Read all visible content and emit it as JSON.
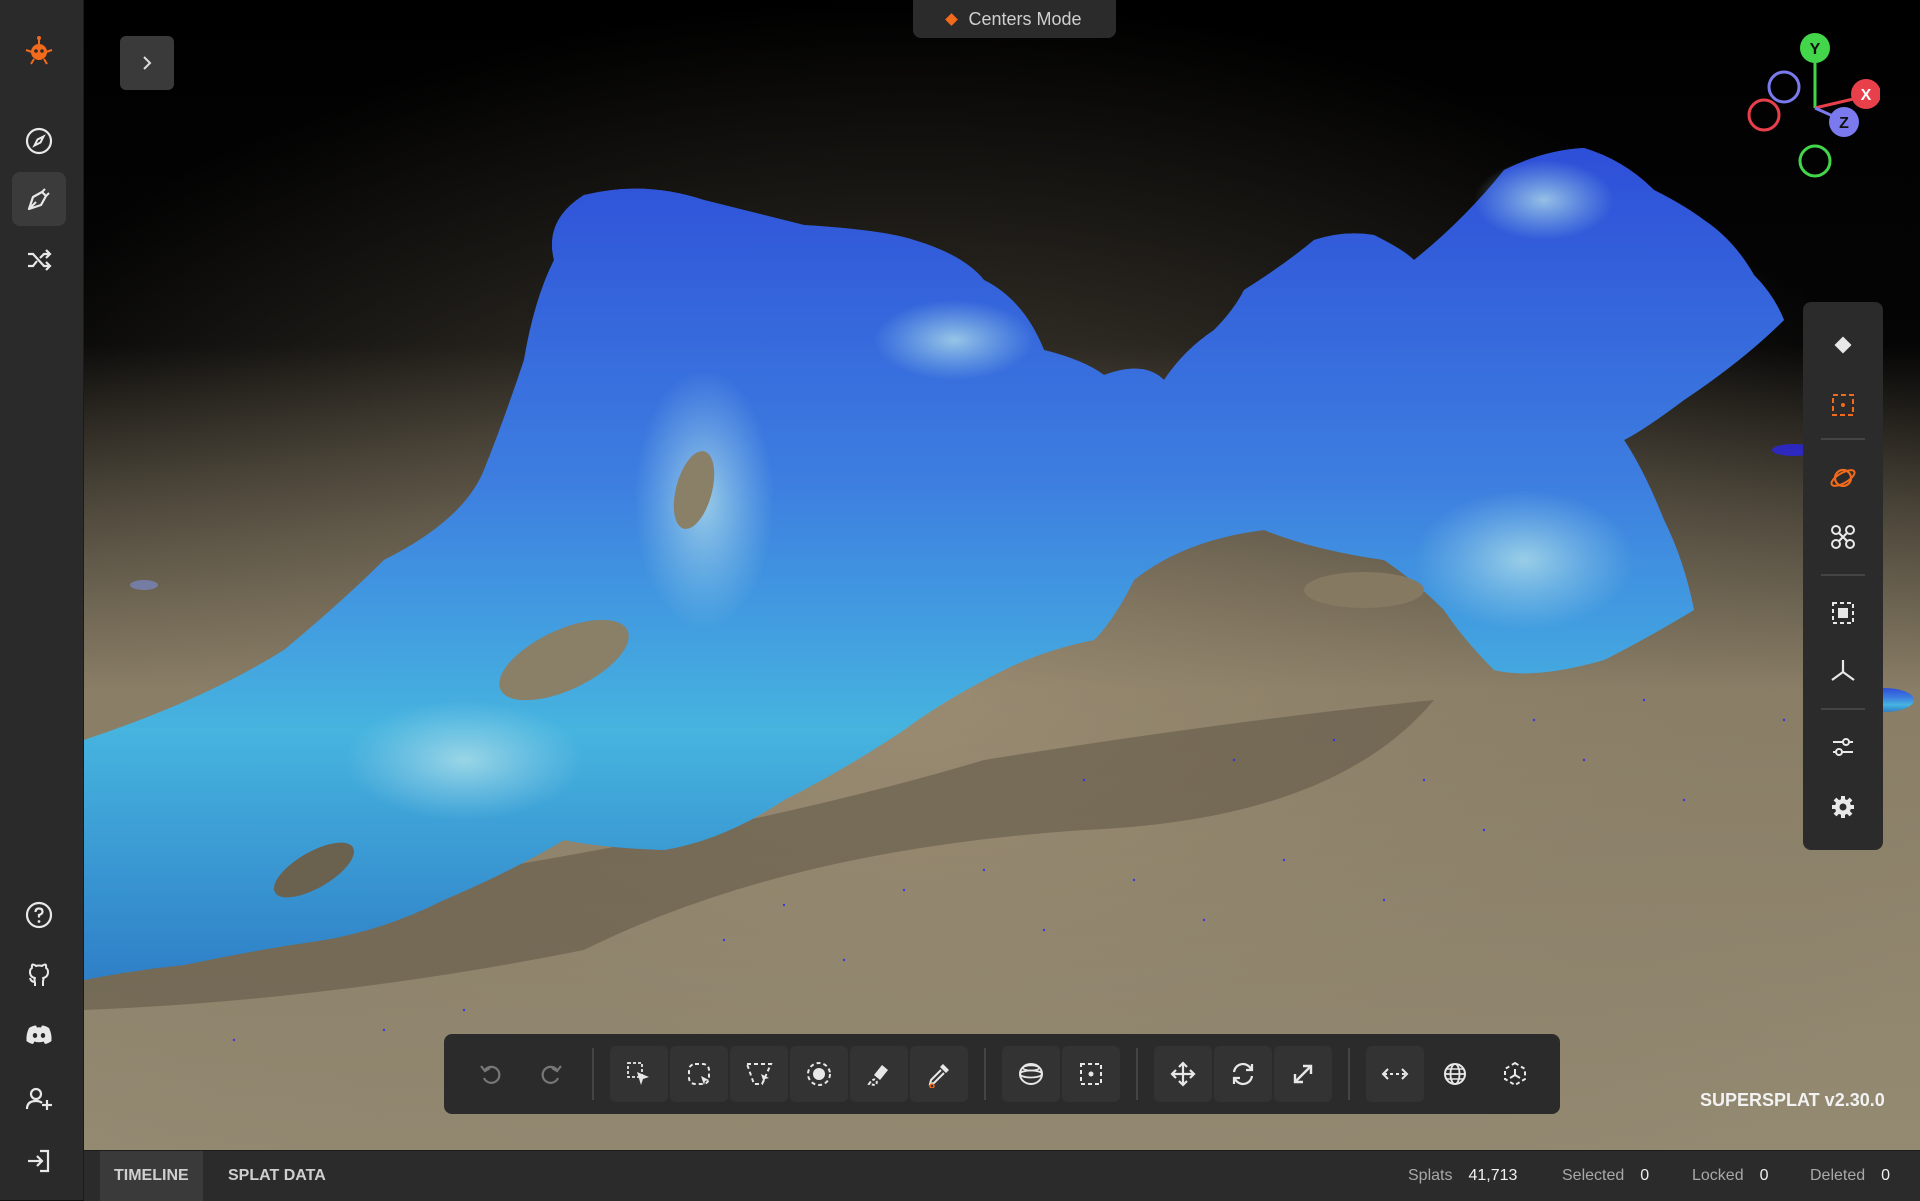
{
  "app": {
    "name": "SuperSplat",
    "version": "SUPERSPLAT v2.30.0",
    "accent": "#f26b1d"
  },
  "mode_pill": {
    "label": "Centers Mode"
  },
  "sidebar": {
    "top": [
      "logo-icon",
      "compass-icon",
      "pen-icon",
      "shuffle-icon"
    ],
    "active": "pen-icon",
    "bottom": [
      "help-icon",
      "github-icon",
      "discord-icon",
      "add-user-icon",
      "login-icon"
    ]
  },
  "gizmo": {
    "x": "X",
    "y": "Y",
    "z": "Z",
    "colors": {
      "x": "#e8404b",
      "y": "#44d64a",
      "z": "#7a7aee"
    }
  },
  "right_toolbar": {
    "items": [
      "diamond-icon",
      "frame-select-icon",
      "orbit-icon",
      "drone-icon",
      "bounding-box-icon",
      "axes-icon",
      "sliders-icon",
      "gear-icon"
    ]
  },
  "bottom_toolbar": {
    "history": [
      "undo-icon",
      "redo-icon"
    ],
    "selection": [
      "pointer-select-icon",
      "lasso-select-icon",
      "polygon-select-icon",
      "sphere-select-icon",
      "brush-select-icon",
      "eyedropper-icon"
    ],
    "volume": [
      "sphere-volume-icon",
      "box-volume-icon"
    ],
    "transform": [
      "move-icon",
      "rotate-icon",
      "scale-icon"
    ],
    "space": [
      "measure-icon",
      "globe-icon",
      "local-axes-icon"
    ]
  },
  "bottom_bar": {
    "tabs": [
      "TIMELINE",
      "SPLAT DATA"
    ],
    "stats": [
      {
        "label": "Splats",
        "value": "41,713"
      },
      {
        "label": "Selected",
        "value": "0"
      },
      {
        "label": "Locked",
        "value": "0"
      },
      {
        "label": "Deleted",
        "value": "0"
      }
    ]
  }
}
